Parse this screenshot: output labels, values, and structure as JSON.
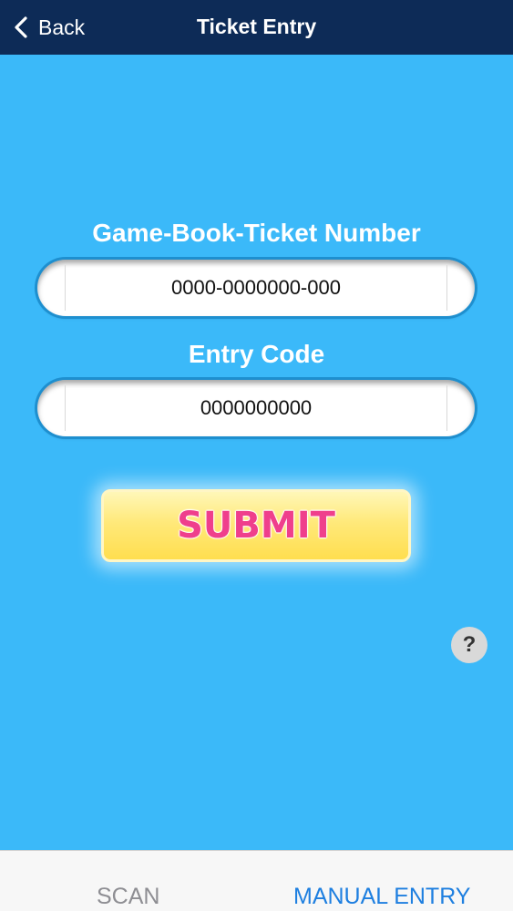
{
  "nav": {
    "back_label": "Back",
    "title": "Ticket Entry"
  },
  "form": {
    "ticket_label": "Game-Book-Ticket Number",
    "ticket_value": "0000-0000000-000",
    "entry_code_label": "Entry Code",
    "entry_code_value": "0000000000",
    "submit_label": "SUBMIT",
    "help_label": "?"
  },
  "tabs": [
    {
      "label": "SCAN",
      "active": false
    },
    {
      "label": "MANUAL ENTRY",
      "active": true
    }
  ],
  "colors": {
    "nav_background": "#0d2b57",
    "page_background": "#3bb9f9",
    "submit_text": "#ef3f8c",
    "submit_fill": "#ffe97a",
    "active_tab": "#1e7fe0",
    "inactive_tab": "#8e8e93"
  },
  "icons": {
    "back": "chevron-left-icon",
    "help": "question-mark-icon"
  }
}
